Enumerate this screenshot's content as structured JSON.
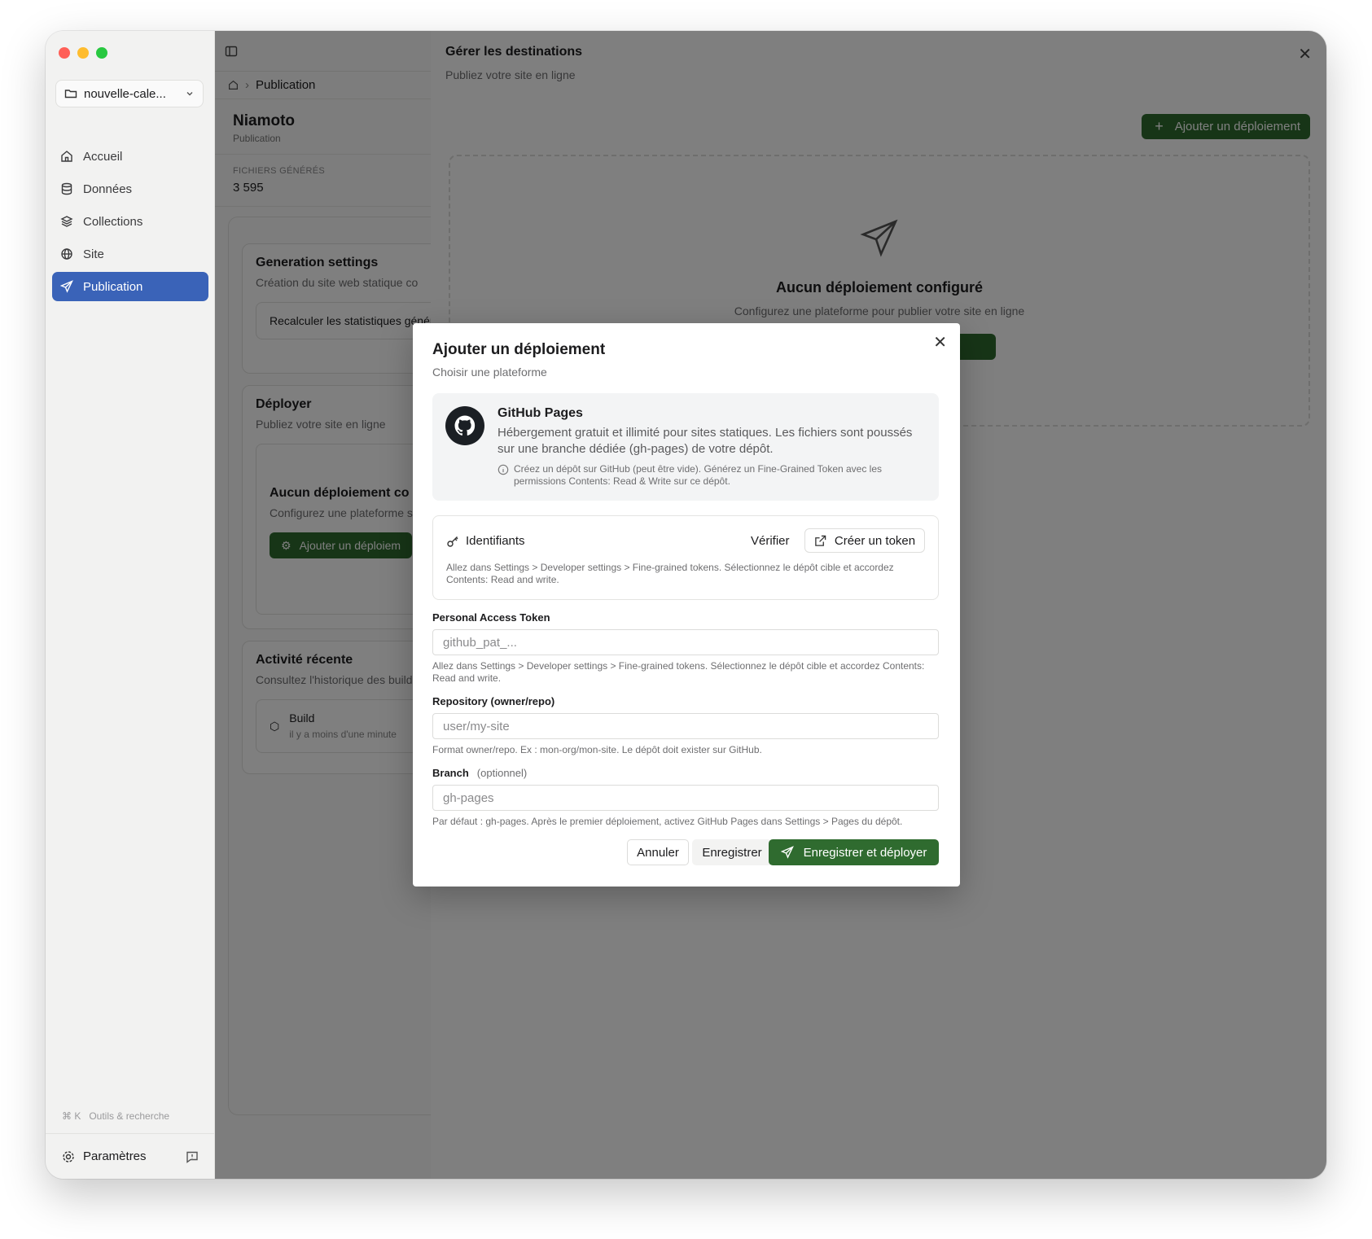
{
  "colors": {
    "accent_green": "#2f6b2f",
    "sidebar_active": "#3a63b8",
    "traffic_red": "#ff5f57",
    "traffic_yellow": "#febc2e",
    "traffic_green": "#28c840"
  },
  "sidebar": {
    "workspace": "nouvelle-cale...",
    "items": [
      {
        "label": "Accueil",
        "icon": "home-icon"
      },
      {
        "label": "Données",
        "icon": "database-icon"
      },
      {
        "label": "Collections",
        "icon": "layers-icon"
      },
      {
        "label": "Site",
        "icon": "globe-icon"
      },
      {
        "label": "Publication",
        "icon": "send-icon",
        "active": true
      }
    ],
    "tools_shortcut": "⌘ K",
    "tools_label": "Outils & recherche",
    "settings_label": "Paramètres"
  },
  "main": {
    "breadcrumb": "Publication",
    "page_title": "Niamoto",
    "page_subtitle": "Publication",
    "stat_label": "FICHIERS GÉNÉRÉS",
    "stat_value": "3 595",
    "generation": {
      "title": "Generation settings",
      "subtitle": "Création du site web statique co",
      "box_text": "Recalculer les statistiques génération"
    },
    "deploy": {
      "title": "Déployer",
      "subtitle": "Publiez votre site en ligne",
      "empty_title": "Aucun déploiement co",
      "empty_text": "Configurez une plateforme site en ligne",
      "button": "Ajouter un déploiem"
    },
    "activity": {
      "title": "Activité récente",
      "subtitle": "Consultez l'historique des builds et déploiements",
      "item_title": "Build",
      "item_time": "il y a moins d'une minute"
    }
  },
  "sheet": {
    "title": "Gérer les destinations",
    "subtitle": "Publiez votre site en ligne",
    "add_button": "Ajouter un déploiement",
    "empty_title": "Aucun déploiement configuré",
    "empty_text": "Configurez une plateforme pour publier votre site en ligne"
  },
  "modal": {
    "title": "Ajouter un déploiement",
    "subtitle": "Choisir une plateforme",
    "platform": {
      "name": "GitHub Pages",
      "description": "Hébergement gratuit et illimité pour sites statiques. Les fichiers sont poussés sur une branche dédiée (gh-pages) de votre dépôt.",
      "note": "Créez un dépôt sur GitHub (peut être vide). Générez un Fine-Grained Token avec les permissions Contents: Read & Write sur ce dépôt."
    },
    "credentials": {
      "label": "Identifiants",
      "verify": "Vérifier",
      "create_token": "Créer un token",
      "help": "Allez dans Settings > Developer settings > Fine-grained tokens. Sélectionnez le dépôt cible et accordez Contents: Read and write."
    },
    "token": {
      "label": "Personal Access Token",
      "placeholder": "github_pat_...",
      "help": "Allez dans Settings > Developer settings > Fine-grained tokens. Sélectionnez le dépôt cible et accordez Contents: Read and write."
    },
    "repo": {
      "label": "Repository (owner/repo)",
      "placeholder": "user/my-site",
      "help": "Format owner/repo. Ex : mon-org/mon-site. Le dépôt doit exister sur GitHub."
    },
    "branch": {
      "label": "Branch",
      "optional": "(optionnel)",
      "placeholder": "gh-pages",
      "help": "Par défaut : gh-pages. Après le premier déploiement, activez GitHub Pages dans Settings > Pages du dépôt."
    },
    "buttons": {
      "cancel": "Annuler",
      "save": "Enregistrer",
      "save_deploy": "Enregistrer et déployer"
    }
  }
}
